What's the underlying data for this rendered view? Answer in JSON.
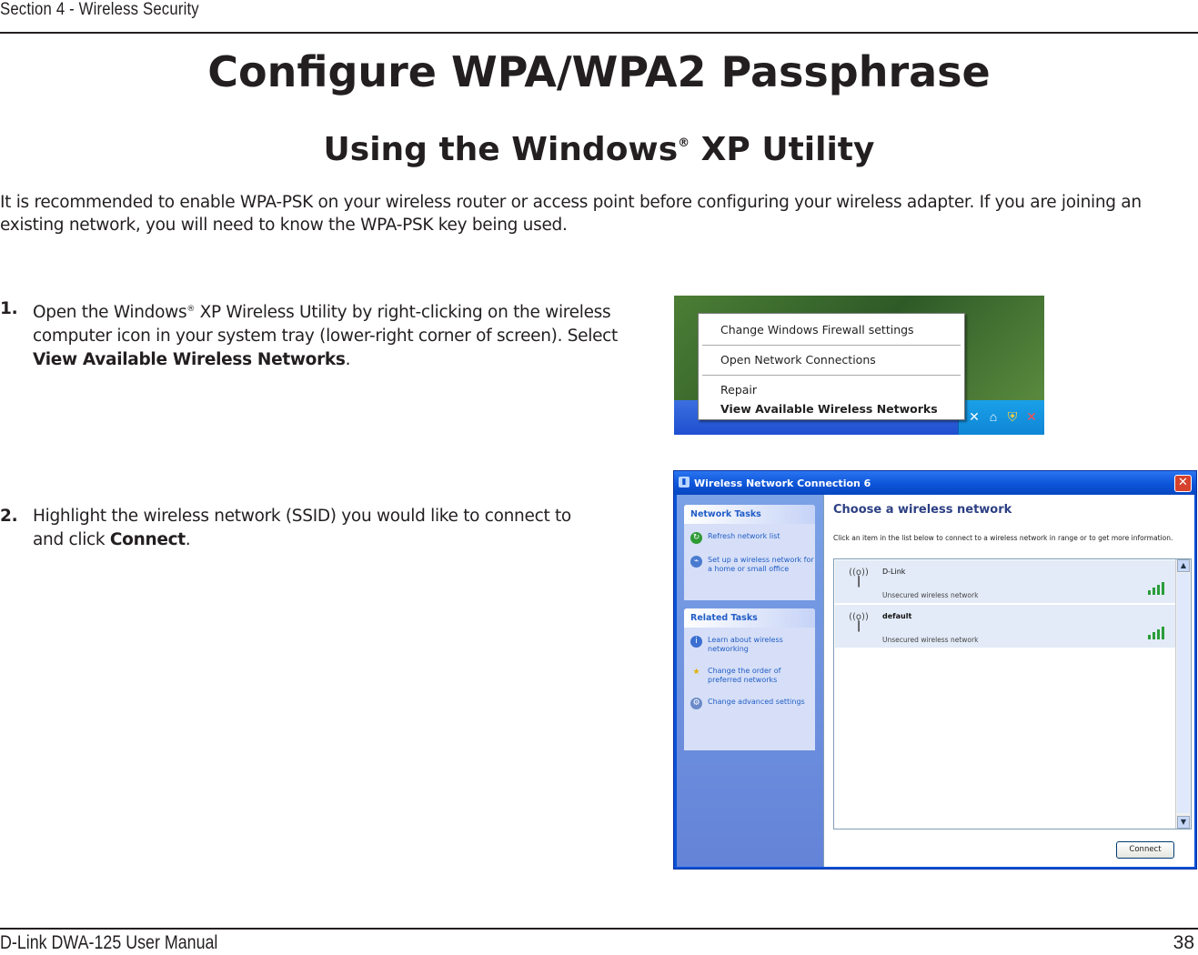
{
  "header": {
    "section": "Section 4 - Wireless Security"
  },
  "title": "Configure WPA/WPA2 Passphrase",
  "subtitle": {
    "pre": "Using the Windows",
    "reg": "®",
    "post": " XP Utility"
  },
  "intro": "It is recommended to enable WPA-PSK on your wireless router or access point before configuring your wireless adapter. If you are joining an existing network, you will need to know the WPA-PSK key being used.",
  "steps": [
    {
      "num": "1.",
      "text_a": "Open the Windows",
      "reg": "®",
      "text_b": " XP Wireless Utility by right-clicking on the wireless computer icon in your system tray (lower-right corner of screen). Select ",
      "bold": "View Available Wireless Networks",
      "end": "."
    },
    {
      "num": "2.",
      "text_a": "Highlight the wireless network (SSID) you would like to connect to and click ",
      "bold": "Connect",
      "end": "."
    }
  ],
  "context_menu": {
    "items": [
      "Change Windows Firewall settings",
      "Open Network Connections",
      "Repair",
      "View Available Wireless Networks"
    ]
  },
  "dialog": {
    "title": "Wireless Network Connection 6",
    "close": "✕",
    "network_tasks": {
      "heading": "Network Tasks",
      "items": [
        "Refresh network list",
        "Set up a wireless network for a home or small office"
      ]
    },
    "related_tasks": {
      "heading": "Related Tasks",
      "items": [
        "Learn about wireless networking",
        "Change the order of preferred networks",
        "Change advanced settings"
      ]
    },
    "choose_title": "Choose a wireless network",
    "choose_desc": "Click an item in the list below to connect to a wireless network in range or to get more information.",
    "networks": [
      {
        "ssid": "D-Link",
        "status": "Unsecured wireless network"
      },
      {
        "ssid": "default",
        "status": "Unsecured wireless network"
      }
    ],
    "connect": "Connect"
  },
  "footer": {
    "left": "D-Link DWA-125 User Manual",
    "page": "38"
  }
}
